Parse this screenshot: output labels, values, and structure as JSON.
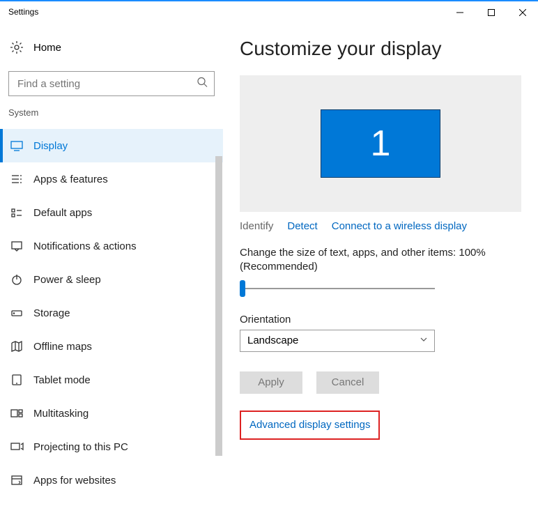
{
  "window": {
    "title": "Settings"
  },
  "home": {
    "label": "Home"
  },
  "search": {
    "placeholder": "Find a setting"
  },
  "category": "System",
  "sidebar": {
    "items": [
      {
        "label": "Display",
        "active": true,
        "icon": "monitor"
      },
      {
        "label": "Apps & features",
        "active": false,
        "icon": "apps"
      },
      {
        "label": "Default apps",
        "active": false,
        "icon": "default-apps"
      },
      {
        "label": "Notifications & actions",
        "active": false,
        "icon": "notifications"
      },
      {
        "label": "Power & sleep",
        "active": false,
        "icon": "power"
      },
      {
        "label": "Storage",
        "active": false,
        "icon": "storage"
      },
      {
        "label": "Offline maps",
        "active": false,
        "icon": "maps"
      },
      {
        "label": "Tablet mode",
        "active": false,
        "icon": "tablet"
      },
      {
        "label": "Multitasking",
        "active": false,
        "icon": "multitasking"
      },
      {
        "label": "Projecting to this PC",
        "active": false,
        "icon": "projecting"
      },
      {
        "label": "Apps for websites",
        "active": false,
        "icon": "apps-websites"
      }
    ]
  },
  "main": {
    "title": "Customize your display",
    "monitor_number": "1",
    "identify_label": "Identify",
    "detect_label": "Detect",
    "wireless_label": "Connect to a wireless display",
    "slider_label": "Change the size of text, apps, and other items: 100% (Recommended)",
    "orientation_label": "Orientation",
    "orientation_value": "Landscape",
    "apply_label": "Apply",
    "cancel_label": "Cancel",
    "advanced_label": "Advanced display settings"
  }
}
